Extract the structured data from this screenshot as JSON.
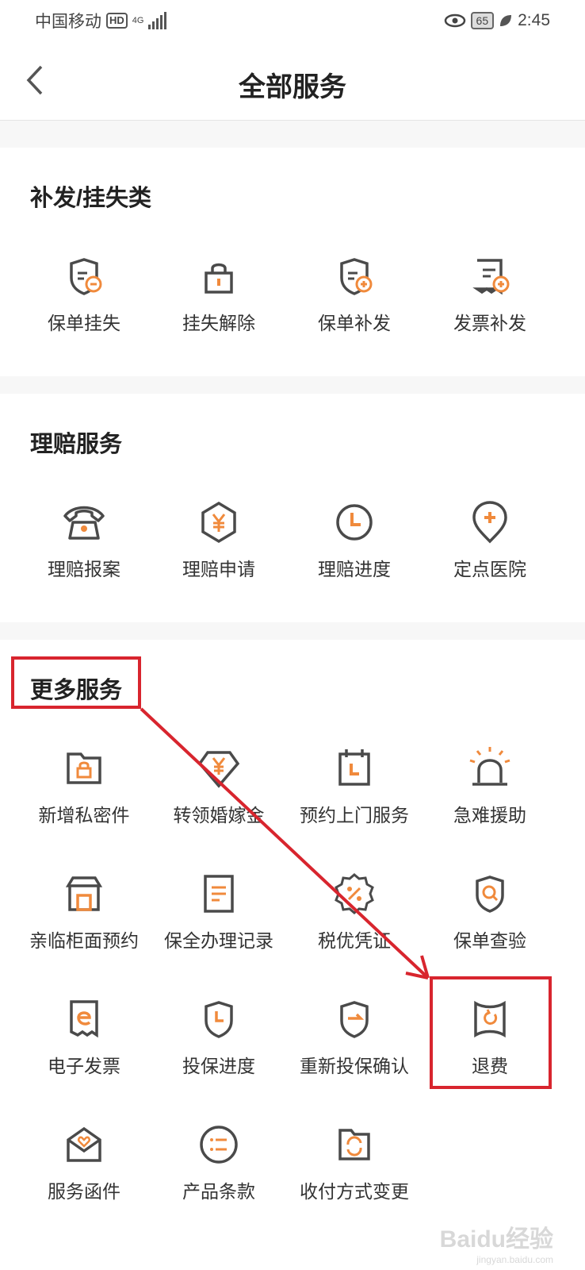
{
  "status_bar": {
    "carrier": "中国移动",
    "hd": "HD",
    "network": "4G",
    "battery": "65",
    "time": "2:45"
  },
  "header": {
    "title": "全部服务"
  },
  "sections": [
    {
      "title": "补发/挂失类",
      "items": [
        {
          "label": "保单挂失",
          "icon": "policy-shield-minus-icon"
        },
        {
          "label": "挂失解除",
          "icon": "padlock-icon"
        },
        {
          "label": "保单补发",
          "icon": "policy-shield-plus-icon"
        },
        {
          "label": "发票补发",
          "icon": "invoice-plus-icon"
        }
      ]
    },
    {
      "title": "理赔服务",
      "items": [
        {
          "label": "理赔报案",
          "icon": "telephone-icon"
        },
        {
          "label": "理赔申请",
          "icon": "yen-hexagon-icon"
        },
        {
          "label": "理赔进度",
          "icon": "clock-icon"
        },
        {
          "label": "定点医院",
          "icon": "map-pin-plus-icon"
        }
      ]
    },
    {
      "title": "更多服务",
      "items": [
        {
          "label": "新增私密件",
          "icon": "folder-lock-icon"
        },
        {
          "label": "转领婚嫁金",
          "icon": "yen-diamond-icon"
        },
        {
          "label": "预约上门服务",
          "icon": "calendar-clock-icon"
        },
        {
          "label": "急难援助",
          "icon": "alarm-light-icon"
        },
        {
          "label": "亲临柜面预约",
          "icon": "store-icon"
        },
        {
          "label": "保全办理记录",
          "icon": "document-lines-icon"
        },
        {
          "label": "税优凭证",
          "icon": "percent-badge-icon"
        },
        {
          "label": "保单查验",
          "icon": "shield-search-icon"
        },
        {
          "label": "电子发票",
          "icon": "e-invoice-icon"
        },
        {
          "label": "投保进度",
          "icon": "shield-clock-icon"
        },
        {
          "label": "重新投保确认",
          "icon": "shield-arrow-icon"
        },
        {
          "label": "退费",
          "icon": "refund-icon"
        },
        {
          "label": "服务函件",
          "icon": "heart-envelope-icon"
        },
        {
          "label": "产品条款",
          "icon": "list-circle-icon"
        },
        {
          "label": "收付方式变更",
          "icon": "folder-refresh-icon"
        }
      ]
    }
  ],
  "watermark": {
    "text": "Baidu经验",
    "url_text": "jingyan.baidu.com"
  },
  "colors": {
    "accent": "#f08a3c",
    "icon_dark": "#4a4a4a",
    "annotation_red": "#d8252e"
  }
}
